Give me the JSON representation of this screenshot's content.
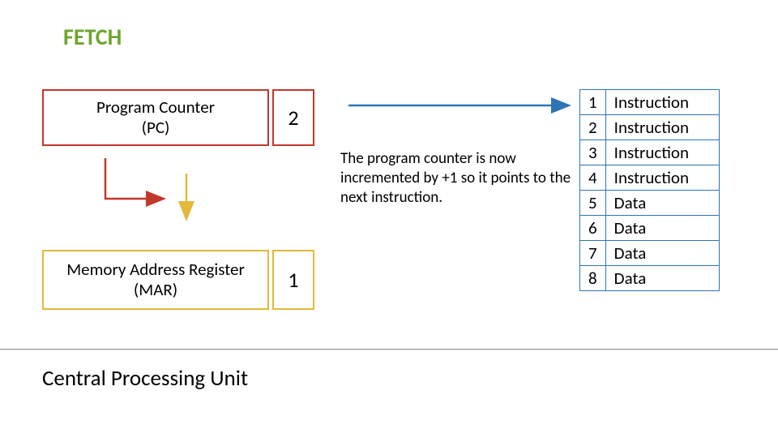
{
  "title": "FETCH",
  "pc": {
    "label": "Program Counter\n(PC)",
    "value": "2"
  },
  "mar": {
    "label": "Memory Address Register\n(MAR)",
    "value": "1"
  },
  "note": "The program counter is now incremented by +1 so it points to the next instruction.",
  "cpu_label": "Central Processing Unit",
  "memory": [
    {
      "addr": "1",
      "content": "Instruction"
    },
    {
      "addr": "2",
      "content": "Instruction"
    },
    {
      "addr": "3",
      "content": "Instruction"
    },
    {
      "addr": "4",
      "content": "Instruction"
    },
    {
      "addr": "5",
      "content": "Data"
    },
    {
      "addr": "6",
      "content": "Data"
    },
    {
      "addr": "7",
      "content": "Data"
    },
    {
      "addr": "8",
      "content": "Data"
    }
  ],
  "colors": {
    "title": "#6ea52f",
    "pc_border": "#c0392b",
    "mar_border": "#e2b93b",
    "table_border": "#2e75b6"
  }
}
